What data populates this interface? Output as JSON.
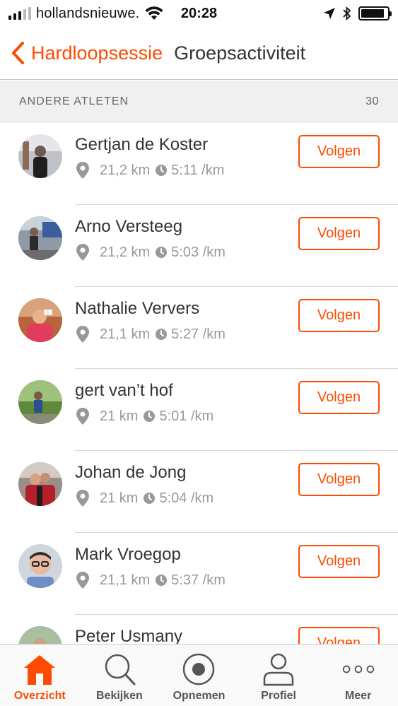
{
  "status_bar": {
    "carrier": "hollandsnieuwe.",
    "time": "20:28",
    "battery_level": 0.9
  },
  "nav": {
    "back_label": "Hardloopsessie",
    "title": "Groepsactiviteit"
  },
  "section": {
    "title": "ANDERE ATLETEN",
    "count": "30"
  },
  "athletes": [
    {
      "name": "Gertjan de Koster",
      "distance": "21,2 km",
      "pace": "5:11 /km",
      "follow_label": "Volgen"
    },
    {
      "name": "Arno Versteeg",
      "distance": "21,2 km",
      "pace": "5:03 /km",
      "follow_label": "Volgen"
    },
    {
      "name": "Nathalie Ververs",
      "distance": "21,1 km",
      "pace": "5:27 /km",
      "follow_label": "Volgen"
    },
    {
      "name": "gert van’t hof",
      "distance": "21 km",
      "pace": "5:01 /km",
      "follow_label": "Volgen"
    },
    {
      "name": "Johan de Jong",
      "distance": "21 km",
      "pace": "5:04 /km",
      "follow_label": "Volgen"
    },
    {
      "name": "Mark Vroegop",
      "distance": "21,1 km",
      "pace": "5:37 /km",
      "follow_label": "Volgen"
    },
    {
      "name": "Peter Usmany",
      "distance": "",
      "pace": "",
      "follow_label": "Volgen"
    }
  ],
  "tabs": [
    {
      "label": "Overzicht",
      "icon": "home-icon",
      "active": true
    },
    {
      "label": "Bekijken",
      "icon": "search-icon",
      "active": false
    },
    {
      "label": "Opnemen",
      "icon": "record-icon",
      "active": false
    },
    {
      "label": "Profiel",
      "icon": "profile-icon",
      "active": false
    },
    {
      "label": "Meer",
      "icon": "more-icon",
      "active": false
    }
  ],
  "colors": {
    "accent": "#FC4C02",
    "text": "#333333",
    "muted": "#999999",
    "section_bg": "#F0F0F0"
  }
}
